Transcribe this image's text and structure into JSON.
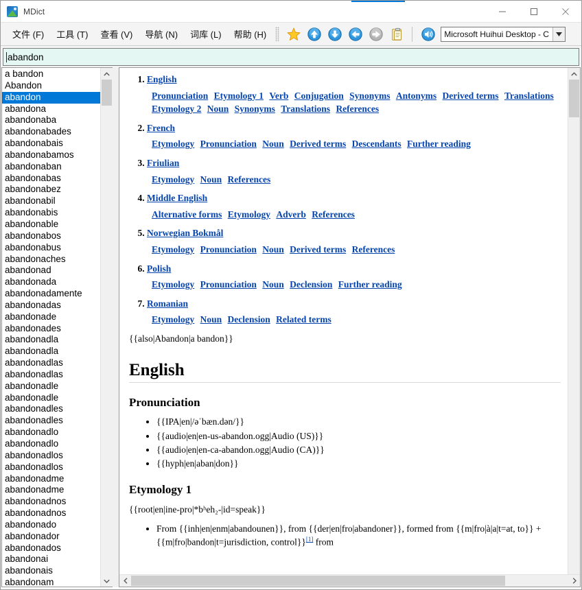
{
  "window": {
    "title": "MDict",
    "app_icon": "mdict-logo-icon",
    "minimize": "minimize-icon",
    "maximize": "maximize-icon",
    "close": "close-icon",
    "accent_color": "#0078d7"
  },
  "menubar": {
    "items": [
      {
        "label": "文件 (F)"
      },
      {
        "label": "工具 (T)"
      },
      {
        "label": "查看 (V)"
      },
      {
        "label": "导航 (N)"
      },
      {
        "label": "词库 (L)"
      },
      {
        "label": "帮助 (H)"
      }
    ]
  },
  "toolbar": {
    "buttons": [
      {
        "name": "favorite-star-icon",
        "glyph": "star"
      },
      {
        "name": "scroll-up-icon",
        "glyph": "arrow-up"
      },
      {
        "name": "scroll-down-icon",
        "glyph": "arrow-down"
      },
      {
        "name": "back-icon",
        "glyph": "arrow-left"
      },
      {
        "name": "forward-icon",
        "glyph": "arrow-right"
      },
      {
        "name": "clipboard-icon",
        "glyph": "clipboard"
      }
    ],
    "speak_icon": "speaker-icon",
    "voice_select": {
      "value": "Microsoft Huihui Desktop - C",
      "arrow_icon": "chevron-down-icon"
    }
  },
  "search": {
    "value": "abandon",
    "placeholder": "abandon"
  },
  "wordlist": {
    "selected": "abandon",
    "items": [
      "a bandon",
      "Abandon",
      "abandon",
      "abandona",
      "abandonaba",
      "abandonabades",
      "abandonabais",
      "abandonabamos",
      "abandonaban",
      "abandonabas",
      "abandonabez",
      "abandonabil",
      "abandonabis",
      "abandonable",
      "abandonabos",
      "abandonabus",
      "abandonaches",
      "abandonad",
      "abandonada",
      "abandonadamente",
      "abandonadas",
      "abandonade",
      "abandonades",
      "abandonadla",
      "abandonadla",
      "abandonadlas",
      "abandonadlas",
      "abandonadle",
      "abandonadle",
      "abandonadles",
      "abandonadles",
      "abandonadlo",
      "abandonadlo",
      "abandonadlos",
      "abandonadlos",
      "abandonadme",
      "abandonadme",
      "abandonadnos",
      "abandonadnos",
      "abandonado",
      "abandonador",
      "abandonados",
      "abandonai",
      "abandonais",
      "abandonam"
    ],
    "scroll_up_icon": "chevron-up-icon",
    "scroll_down_icon": "chevron-down-icon"
  },
  "content": {
    "toc": [
      {
        "language": "English",
        "subsections": [
          "Pronunciation",
          "Etymology 1",
          "Verb",
          "Conjugation",
          "Synonyms",
          "Antonyms",
          "Derived terms",
          "Translations",
          "Etymology 2",
          "Noun",
          "Synonyms",
          "Translations",
          "References"
        ]
      },
      {
        "language": "French",
        "subsections": [
          "Etymology",
          "Pronunciation",
          "Noun",
          "Derived terms",
          "Descendants",
          "Further reading"
        ]
      },
      {
        "language": "Friulian",
        "subsections": [
          "Etymology",
          "Noun",
          "References"
        ]
      },
      {
        "language": "Middle English",
        "subsections": [
          "Alternative forms",
          "Etymology",
          "Adverb",
          "References"
        ]
      },
      {
        "language": "Norwegian Bokmål",
        "subsections": [
          "Etymology",
          "Pronunciation",
          "Noun",
          "Derived terms",
          "References"
        ]
      },
      {
        "language": "Polish",
        "subsections": [
          "Etymology",
          "Pronunciation",
          "Noun",
          "Declension",
          "Further reading"
        ]
      },
      {
        "language": "Romanian",
        "subsections": [
          "Etymology",
          "Noun",
          "Declension",
          "Related terms"
        ]
      }
    ],
    "also_line": "{{also|Abandon|a bandon}}",
    "language_heading": "English",
    "pronunciation_heading": "Pronunciation",
    "pronunciation_items": [
      "{{IPA|en|/əˈbæn.dən/}}",
      "{{audio|en|en-us-abandon.ogg|Audio (US)}}",
      "{{audio|en|en-ca-abandon.ogg|Audio (CA)}}",
      "{{hyph|en|aban|don}}"
    ],
    "etymology_heading": "Etymology 1",
    "etymology_root": "{{root|en|ine-pro|*bʰeh₂-|id=speak}}",
    "etymology_bullet_line1": "From {{inh|en|enm|abandounen}}, from {{der|en|fro|abandoner}}, formed from",
    "etymology_bullet_line2": "{{m|fro|à|a|t=at, to}} + {{m|fro|bandon|t=jurisdiction, control}}",
    "etymology_ref": "[1]",
    "etymology_bullet_line2_tail": " from",
    "vscroll_up_icon": "chevron-up-icon",
    "hscroll_left_icon": "chevron-left-icon",
    "hscroll_right_icon": "chevron-right-icon"
  }
}
